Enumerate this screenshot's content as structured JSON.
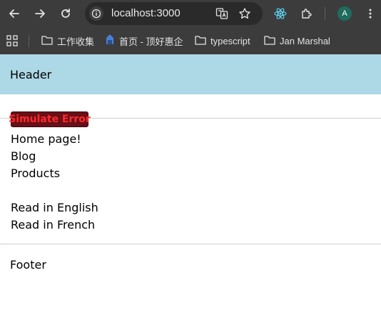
{
  "browser": {
    "url": "localhost:3000",
    "profile_initial": "A",
    "bookmarks": [
      {
        "label": "工作收集",
        "icon": "folder-icon"
      },
      {
        "label": "首页 - 顶好惠企",
        "icon": "site-favicon-icon"
      },
      {
        "label": "typescript",
        "icon": "folder-icon"
      },
      {
        "label": "Jan Marshal",
        "icon": "folder-icon"
      }
    ]
  },
  "page": {
    "header": "Header",
    "simulate_error_button": "Simulate Error",
    "links": [
      "Home page!",
      "Blog",
      "Products"
    ],
    "language_links": [
      "Read in English",
      "Read in French"
    ],
    "footer": "Footer"
  },
  "colors": {
    "header_bg": "#add8e6",
    "error_button_bg": "#6a0f17",
    "error_button_text": "#ff2a2a",
    "chrome_bg": "#3c3c3c"
  }
}
